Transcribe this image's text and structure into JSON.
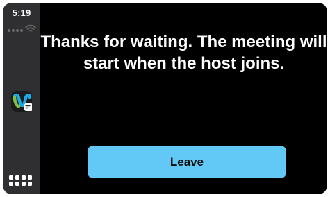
{
  "status_bar": {
    "time": "5:19"
  },
  "sidebar": {
    "app_icon": "webex-app-icon",
    "home_icon": "app-grid-icon"
  },
  "meeting": {
    "message": "Thanks for waiting. The meeting will start when the host joins.",
    "leave_label": "Leave"
  },
  "colors": {
    "sidebar_bg": "#2f2f31",
    "screen_bg": "#000000",
    "button_bg": "#62c9f6",
    "button_text": "#0d0d0d"
  }
}
